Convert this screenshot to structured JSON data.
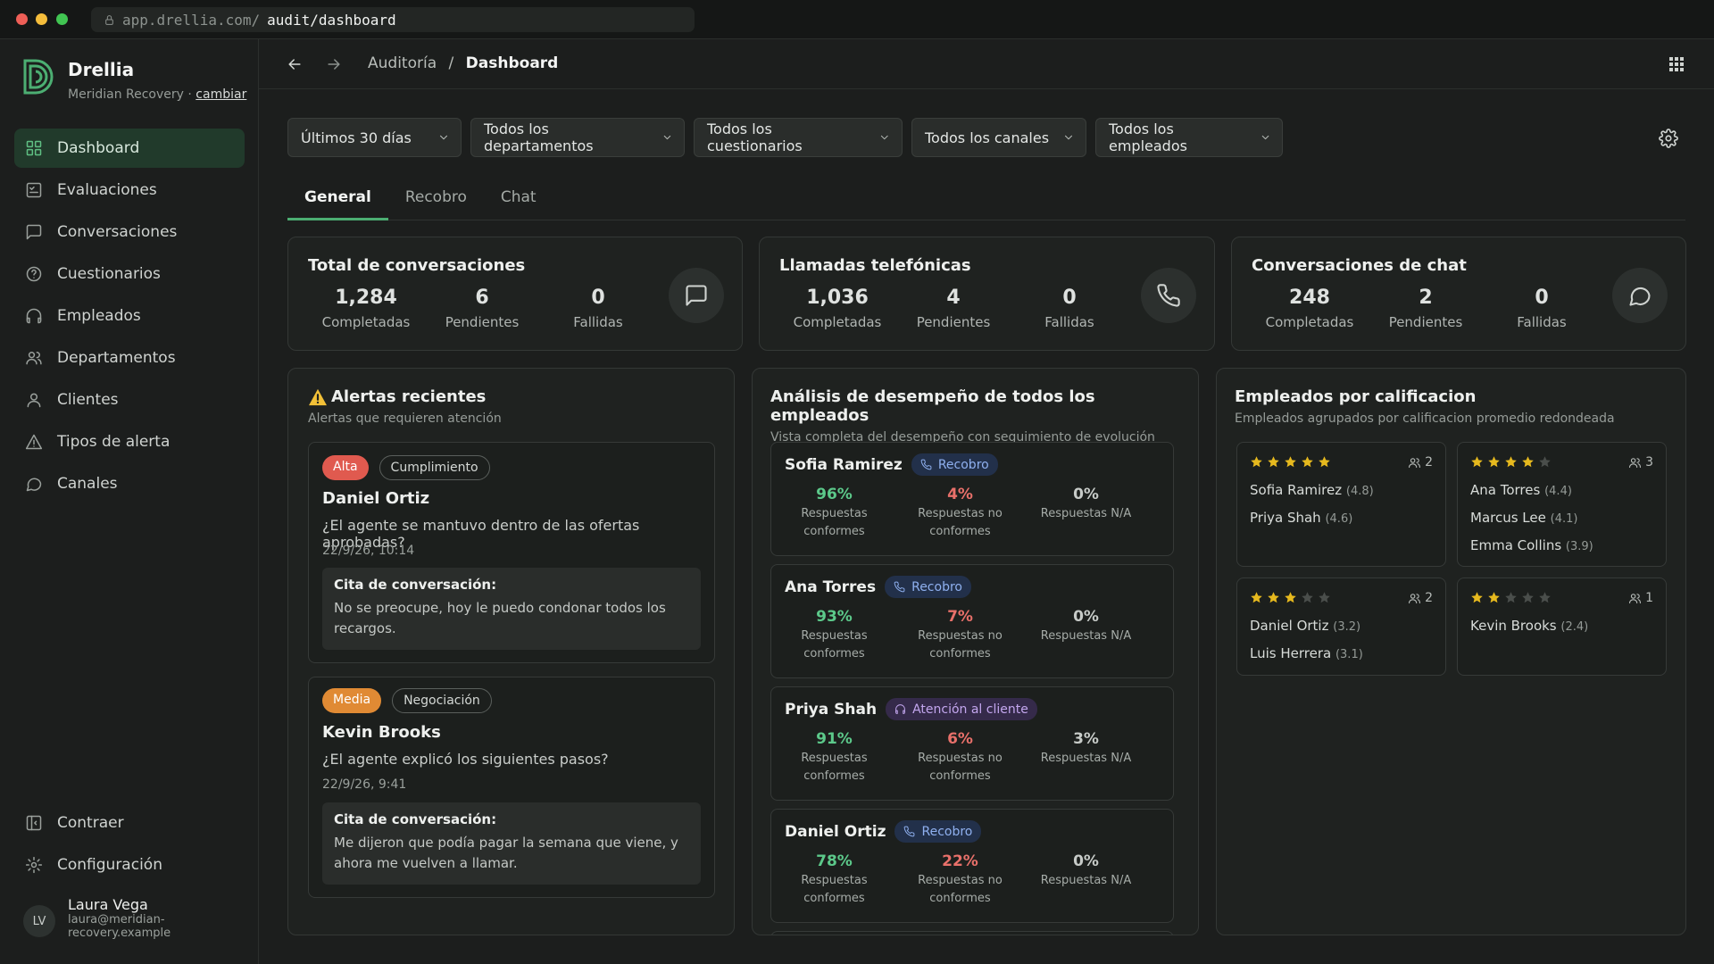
{
  "browser": {
    "url_host": "app.drellia.com/",
    "url_path": "audit/dashboard"
  },
  "brand": {
    "name": "Drellia",
    "org": "Meridian Recovery",
    "separator": "·",
    "switch_label": "cambiar"
  },
  "nav": {
    "items": [
      {
        "label": "Dashboard",
        "icon": "grid-icon"
      },
      {
        "label": "Evaluaciones",
        "icon": "checklist-icon"
      },
      {
        "label": "Conversaciones",
        "icon": "message-square-icon"
      },
      {
        "label": "Cuestionarios",
        "icon": "help-circle-icon"
      },
      {
        "label": "Empleados",
        "icon": "headphones-icon"
      },
      {
        "label": "Departamentos",
        "icon": "users-icon"
      },
      {
        "label": "Clientes",
        "icon": "user-icon"
      },
      {
        "label": "Tipos de alerta",
        "icon": "alert-triangle-icon"
      },
      {
        "label": "Canales",
        "icon": "message-circle-icon"
      }
    ],
    "collapse_label": "Contraer",
    "settings_label": "Configuración"
  },
  "user": {
    "initials": "LV",
    "name": "Laura Vega",
    "email": "laura@meridian-recovery.example"
  },
  "breadcrumb": {
    "parent": "Auditoría",
    "separator": "/",
    "current": "Dashboard"
  },
  "filters": [
    "Últimos 30 días",
    "Todos los departamentos",
    "Todos los cuestionarios",
    "Todos los canales",
    "Todos los empleados"
  ],
  "tabs": [
    "General",
    "Recobro",
    "Chat"
  ],
  "stats": [
    {
      "title": "Total de conversaciones",
      "values": [
        "1,284",
        "6",
        "0"
      ],
      "labels": [
        "Completadas",
        "Pendientes",
        "Fallidas"
      ],
      "icon": "message-square-icon"
    },
    {
      "title": "Llamadas telefónicas",
      "values": [
        "1,036",
        "4",
        "0"
      ],
      "labels": [
        "Completadas",
        "Pendientes",
        "Fallidas"
      ],
      "icon": "phone-icon"
    },
    {
      "title": "Conversaciones de chat",
      "values": [
        "248",
        "2",
        "0"
      ],
      "labels": [
        "Completadas",
        "Pendientes",
        "Fallidas"
      ],
      "icon": "message-circle-icon"
    }
  ],
  "alerts": {
    "title": "Alertas recientes",
    "subtitle": "Alertas que requieren atención",
    "items": [
      {
        "severity": "Alta",
        "category": "Cumplimiento",
        "name": "Daniel Ortiz",
        "question": "¿El agente se mantuvo dentro de las ofertas aprobadas?",
        "date": "22/9/26, 10:14",
        "quote_label": "Cita de conversación:",
        "quote": "No se preocupe, hoy le puedo condonar todos los recargos.",
        "severity_color": "#e05a4f"
      },
      {
        "severity": "Media",
        "category": "Negociación",
        "name": "Kevin Brooks",
        "question": "¿El agente explicó los siguientes pasos?",
        "date": "22/9/26, 9:41",
        "quote_label": "Cita de conversación:",
        "quote": "Me dijeron que podía pagar la semana que viene, y ahora me vuelven a llamar.",
        "severity_color": "#e08a34"
      }
    ]
  },
  "performance": {
    "title": "Análisis de desempeño de todos los empleados",
    "subtitle": "Vista completa del desempeño con seguimiento de evolución",
    "labels": {
      "conform": "Respuestas conformes",
      "nonconform": "Respuestas no conformes",
      "na": "Respuestas N/A"
    },
    "employees": [
      {
        "name": "Sofia Ramirez",
        "tag": "Recobro",
        "tag_icon": "phone-icon",
        "conform": "96%",
        "nonconform": "4%",
        "na": "0%"
      },
      {
        "name": "Ana Torres",
        "tag": "Recobro",
        "tag_icon": "phone-icon",
        "conform": "93%",
        "nonconform": "7%",
        "na": "0%"
      },
      {
        "name": "Priya Shah",
        "tag": "Atención al cliente",
        "tag_icon": "headphones-icon",
        "conform": "91%",
        "nonconform": "6%",
        "na": "3%"
      },
      {
        "name": "Daniel Ortiz",
        "tag": "Recobro",
        "tag_icon": "phone-icon",
        "conform": "78%",
        "nonconform": "22%",
        "na": "0%"
      }
    ]
  },
  "ratings": {
    "title": "Empleados por calificacion",
    "subtitle": "Empleados agrupados por calificacion promedio redondeada",
    "groups": [
      {
        "stars": 5,
        "count": "2",
        "people": [
          {
            "name": "Sofia Ramirez",
            "score": "(4.8)"
          },
          {
            "name": "Priya Shah",
            "score": "(4.6)"
          }
        ]
      },
      {
        "stars": 4,
        "count": "3",
        "people": [
          {
            "name": "Ana Torres",
            "score": "(4.4)"
          },
          {
            "name": "Marcus Lee",
            "score": "(4.1)"
          },
          {
            "name": "Emma Collins",
            "score": "(3.9)"
          }
        ]
      },
      {
        "stars": 3,
        "count": "2",
        "people": [
          {
            "name": "Daniel Ortiz",
            "score": "(3.2)"
          },
          {
            "name": "Luis Herrera",
            "score": "(3.1)"
          }
        ]
      },
      {
        "stars": 2,
        "count": "1",
        "people": [
          {
            "name": "Kevin Brooks",
            "score": "(2.4)"
          }
        ]
      }
    ]
  },
  "colors": {
    "accent": "#4cae72",
    "good": "#5cc98a",
    "bad": "#e8706a",
    "star_on": "#e6b91e",
    "star_off": "#4a4e4b",
    "tag_blue": "#8fb0ef"
  }
}
